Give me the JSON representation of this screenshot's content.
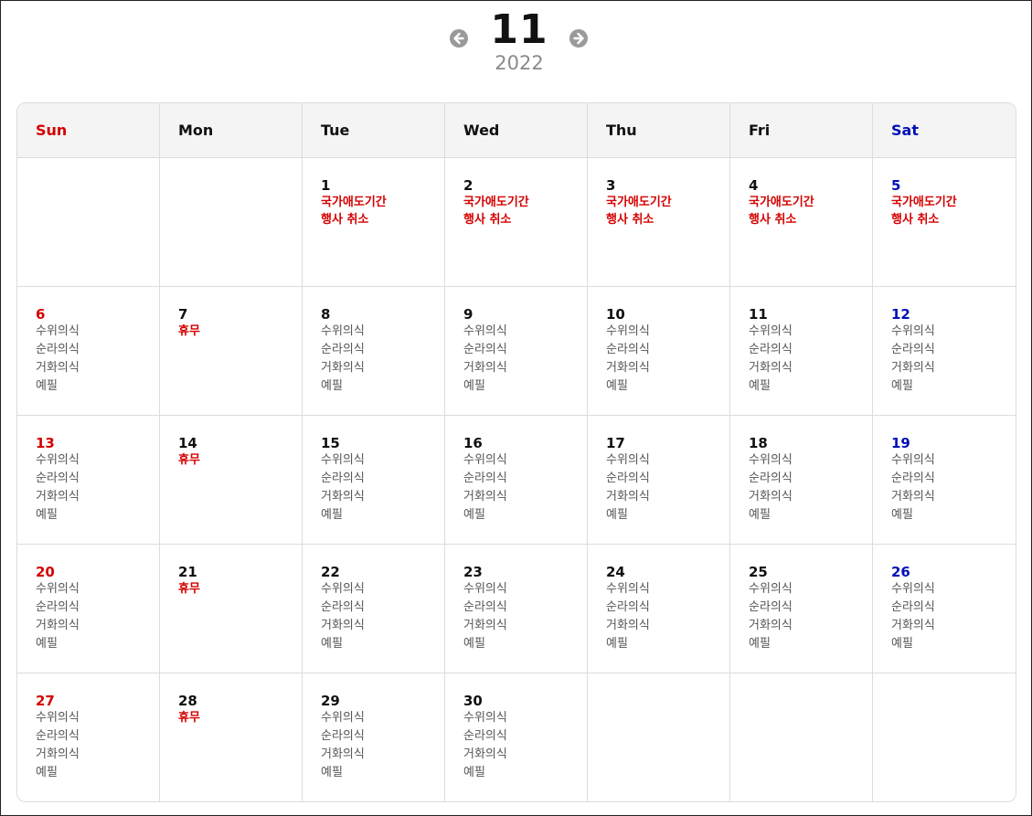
{
  "header": {
    "month": "11",
    "year": "2022"
  },
  "weekdays": [
    {
      "label": "Sun",
      "kind": "sun"
    },
    {
      "label": "Mon",
      "kind": ""
    },
    {
      "label": "Tue",
      "kind": ""
    },
    {
      "label": "Wed",
      "kind": ""
    },
    {
      "label": "Thu",
      "kind": ""
    },
    {
      "label": "Fri",
      "kind": ""
    },
    {
      "label": "Sat",
      "kind": "sat"
    }
  ],
  "colors": {
    "sunday": "#d40000",
    "saturday": "#0010b8",
    "notice": "#d40000",
    "event": "#555555"
  },
  "weeks": [
    [
      null,
      null,
      {
        "day": "1",
        "events": [
          {
            "text": "국가애도기간",
            "style": "red"
          },
          {
            "text": "행사 취소",
            "style": "red"
          }
        ]
      },
      {
        "day": "2",
        "events": [
          {
            "text": "국가애도기간",
            "style": "red"
          },
          {
            "text": "행사 취소",
            "style": "red"
          }
        ]
      },
      {
        "day": "3",
        "events": [
          {
            "text": "국가애도기간",
            "style": "red"
          },
          {
            "text": "행사 취소",
            "style": "red"
          }
        ]
      },
      {
        "day": "4",
        "events": [
          {
            "text": "국가애도기간",
            "style": "red"
          },
          {
            "text": "행사 취소",
            "style": "red"
          }
        ]
      },
      {
        "day": "5",
        "events": [
          {
            "text": "국가애도기간",
            "style": "red"
          },
          {
            "text": "행사 취소",
            "style": "red"
          }
        ]
      }
    ],
    [
      {
        "day": "6",
        "events": [
          {
            "text": "수위의식"
          },
          {
            "text": "순라의식"
          },
          {
            "text": "거화의식"
          },
          {
            "text": "예필"
          }
        ]
      },
      {
        "day": "7",
        "events": [
          {
            "text": "휴무",
            "style": "red"
          }
        ]
      },
      {
        "day": "8",
        "events": [
          {
            "text": "수위의식"
          },
          {
            "text": "순라의식"
          },
          {
            "text": "거화의식"
          },
          {
            "text": "예필"
          }
        ]
      },
      {
        "day": "9",
        "events": [
          {
            "text": "수위의식"
          },
          {
            "text": "순라의식"
          },
          {
            "text": "거화의식"
          },
          {
            "text": "예필"
          }
        ]
      },
      {
        "day": "10",
        "events": [
          {
            "text": "수위의식"
          },
          {
            "text": "순라의식"
          },
          {
            "text": "거화의식"
          },
          {
            "text": "예필"
          }
        ]
      },
      {
        "day": "11",
        "events": [
          {
            "text": "수위의식"
          },
          {
            "text": "순라의식"
          },
          {
            "text": "거화의식"
          },
          {
            "text": "예필"
          }
        ]
      },
      {
        "day": "12",
        "events": [
          {
            "text": "수위의식"
          },
          {
            "text": "순라의식"
          },
          {
            "text": "거화의식"
          },
          {
            "text": "예필"
          }
        ]
      }
    ],
    [
      {
        "day": "13",
        "events": [
          {
            "text": "수위의식"
          },
          {
            "text": "순라의식"
          },
          {
            "text": "거화의식"
          },
          {
            "text": "예필"
          }
        ]
      },
      {
        "day": "14",
        "events": [
          {
            "text": "휴무",
            "style": "red"
          }
        ]
      },
      {
        "day": "15",
        "events": [
          {
            "text": "수위의식"
          },
          {
            "text": "순라의식"
          },
          {
            "text": "거화의식"
          },
          {
            "text": "예필"
          }
        ]
      },
      {
        "day": "16",
        "events": [
          {
            "text": "수위의식"
          },
          {
            "text": "순라의식"
          },
          {
            "text": "거화의식"
          },
          {
            "text": "예필"
          }
        ]
      },
      {
        "day": "17",
        "events": [
          {
            "text": "수위의식"
          },
          {
            "text": "순라의식"
          },
          {
            "text": "거화의식"
          },
          {
            "text": "예필"
          }
        ]
      },
      {
        "day": "18",
        "events": [
          {
            "text": "수위의식"
          },
          {
            "text": "순라의식"
          },
          {
            "text": "거화의식"
          },
          {
            "text": "예필"
          }
        ]
      },
      {
        "day": "19",
        "events": [
          {
            "text": "수위의식"
          },
          {
            "text": "순라의식"
          },
          {
            "text": "거화의식"
          },
          {
            "text": "예필"
          }
        ]
      }
    ],
    [
      {
        "day": "20",
        "events": [
          {
            "text": "수위의식"
          },
          {
            "text": "순라의식"
          },
          {
            "text": "거화의식"
          },
          {
            "text": "예필"
          }
        ]
      },
      {
        "day": "21",
        "events": [
          {
            "text": "휴무",
            "style": "red"
          }
        ]
      },
      {
        "day": "22",
        "events": [
          {
            "text": "수위의식"
          },
          {
            "text": "순라의식"
          },
          {
            "text": "거화의식"
          },
          {
            "text": "예필"
          }
        ]
      },
      {
        "day": "23",
        "events": [
          {
            "text": "수위의식"
          },
          {
            "text": "순라의식"
          },
          {
            "text": "거화의식"
          },
          {
            "text": "예필"
          }
        ]
      },
      {
        "day": "24",
        "events": [
          {
            "text": "수위의식"
          },
          {
            "text": "순라의식"
          },
          {
            "text": "거화의식"
          },
          {
            "text": "예필"
          }
        ]
      },
      {
        "day": "25",
        "events": [
          {
            "text": "수위의식"
          },
          {
            "text": "순라의식"
          },
          {
            "text": "거화의식"
          },
          {
            "text": "예필"
          }
        ]
      },
      {
        "day": "26",
        "events": [
          {
            "text": "수위의식"
          },
          {
            "text": "순라의식"
          },
          {
            "text": "거화의식"
          },
          {
            "text": "예필"
          }
        ]
      }
    ],
    [
      {
        "day": "27",
        "events": [
          {
            "text": "수위의식"
          },
          {
            "text": "순라의식"
          },
          {
            "text": "거화의식"
          },
          {
            "text": "예필"
          }
        ]
      },
      {
        "day": "28",
        "events": [
          {
            "text": "휴무",
            "style": "red"
          }
        ]
      },
      {
        "day": "29",
        "events": [
          {
            "text": "수위의식"
          },
          {
            "text": "순라의식"
          },
          {
            "text": "거화의식"
          },
          {
            "text": "예필"
          }
        ]
      },
      {
        "day": "30",
        "events": [
          {
            "text": "수위의식"
          },
          {
            "text": "순라의식"
          },
          {
            "text": "거화의식"
          },
          {
            "text": "예필"
          }
        ]
      },
      null,
      null,
      null
    ]
  ]
}
